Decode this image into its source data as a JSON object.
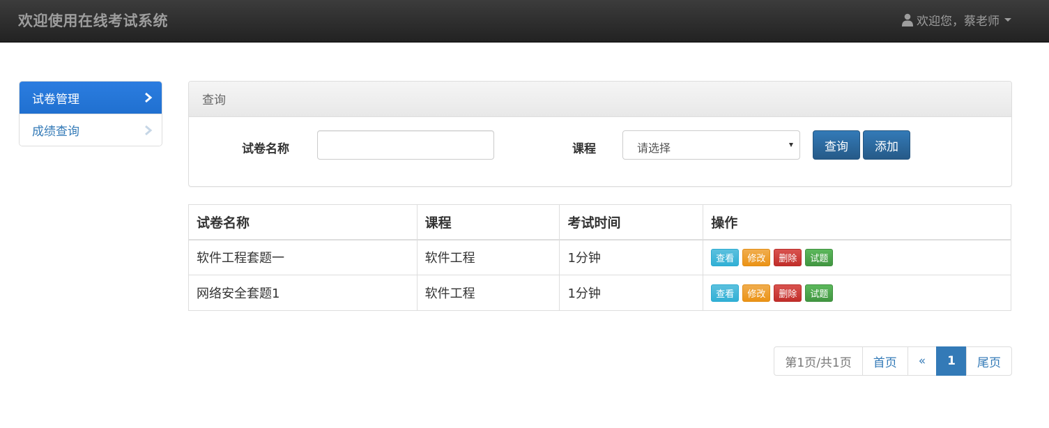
{
  "navbar": {
    "brand": "欢迎使用在线考试系统",
    "user_greeting": "欢迎您，蔡老师"
  },
  "sidebar": {
    "items": [
      {
        "label": "试卷管理",
        "active": true
      },
      {
        "label": "成绩查询",
        "active": false
      }
    ]
  },
  "query": {
    "heading": "查询",
    "paper_name_label": "试卷名称",
    "paper_name_value": "",
    "course_label": "课程",
    "course_selected": "请选择",
    "search_button": "查询",
    "add_button": "添加"
  },
  "table": {
    "headers": [
      "试卷名称",
      "课程",
      "考试时间",
      "操作"
    ],
    "rows": [
      {
        "name": "软件工程套题一",
        "course": "软件工程",
        "duration": "1分钟"
      },
      {
        "name": "网络安全套题1",
        "course": "软件工程",
        "duration": "1分钟"
      }
    ],
    "actions": {
      "view": "查看",
      "edit": "修改",
      "delete": "删除",
      "questions": "试题"
    }
  },
  "pagination": {
    "info": "第1页/共1页",
    "first": "首页",
    "prev": "«",
    "current": "1",
    "last": "尾页"
  },
  "colors": {
    "primary": "#337ab7",
    "info": "#5bc0de",
    "warning": "#f0ad4e",
    "danger": "#d9534f",
    "success": "#5cb85c",
    "navbar": "#222222"
  }
}
